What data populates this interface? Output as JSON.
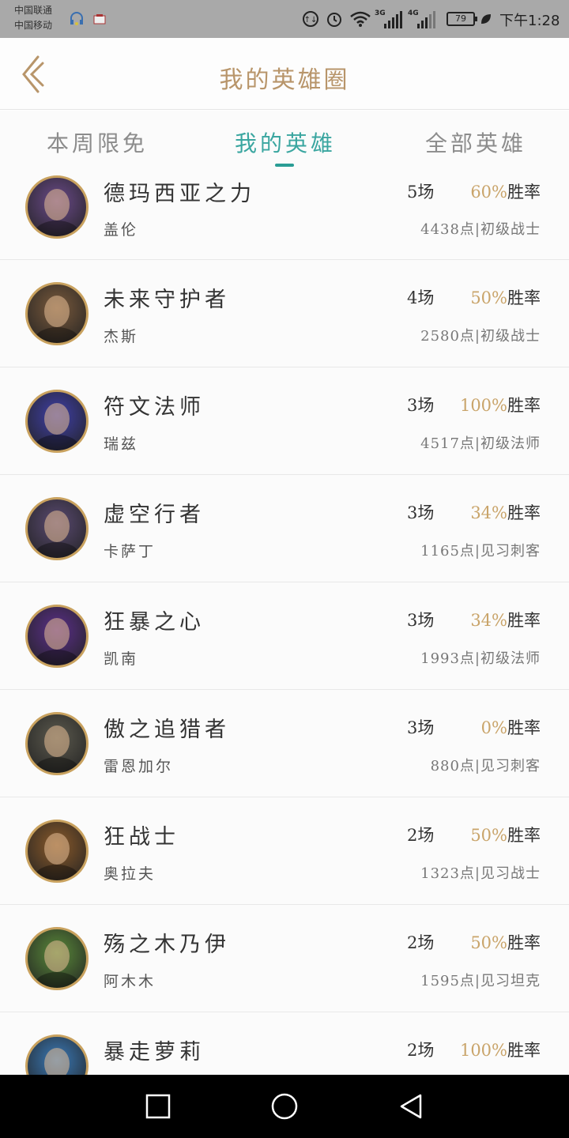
{
  "status_bar": {
    "carrier_1": "中国联通",
    "carrier_2": "中国移动",
    "net_1": "3G",
    "net_2": "4G",
    "battery": "79",
    "time": "下午1:28"
  },
  "header": {
    "title": "我的英雄圈"
  },
  "tabs": [
    {
      "label": "本周限免",
      "active": false
    },
    {
      "label": "我的英雄",
      "active": true
    },
    {
      "label": "全部英雄",
      "active": false
    }
  ],
  "heroes": [
    {
      "title": "德玛西亚之力",
      "name": "盖伦",
      "games": "5场",
      "win_pct": "60%",
      "win_label": "胜率",
      "points": "4438点|初级战士",
      "avatar_color": "#6b4a8a"
    },
    {
      "title": "未来守护者",
      "name": "杰斯",
      "games": "4场",
      "win_pct": "50%",
      "win_label": "胜率",
      "points": "2580点|初级战士",
      "avatar_color": "#7a5a3c"
    },
    {
      "title": "符文法师",
      "name": "瑞兹",
      "games": "3场",
      "win_pct": "100%",
      "win_label": "胜率",
      "points": "4517点|初级法师",
      "avatar_color": "#3f3fa8"
    },
    {
      "title": "虚空行者",
      "name": "卡萨丁",
      "games": "3场",
      "win_pct": "34%",
      "win_label": "胜率",
      "points": "1165点|见习刺客",
      "avatar_color": "#5a4a72"
    },
    {
      "title": "狂暴之心",
      "name": "凯南",
      "games": "3场",
      "win_pct": "34%",
      "win_label": "胜率",
      "points": "1993点|初级法师",
      "avatar_color": "#5b2f8a"
    },
    {
      "title": "傲之追猎者",
      "name": "雷恩加尔",
      "games": "3场",
      "win_pct": "0%",
      "win_label": "胜率",
      "points": "880点|见习刺客",
      "avatar_color": "#5c5a4e"
    },
    {
      "title": "狂战士",
      "name": "奥拉夫",
      "games": "2场",
      "win_pct": "50%",
      "win_label": "胜率",
      "points": "1323点|见习战士",
      "avatar_color": "#8a5a2a"
    },
    {
      "title": "殇之木乃伊",
      "name": "阿木木",
      "games": "2场",
      "win_pct": "50%",
      "win_label": "胜率",
      "points": "1595点|见习坦克",
      "avatar_color": "#5a8a3a"
    },
    {
      "title": "暴走萝莉",
      "name": "",
      "games": "2场",
      "win_pct": "100%",
      "win_label": "胜率",
      "points": "",
      "avatar_color": "#3a7ab8"
    }
  ],
  "colors": {
    "accent_gold": "#b8956a",
    "tab_active": "#3aa6a0",
    "win_pct": "#c9a46a"
  }
}
